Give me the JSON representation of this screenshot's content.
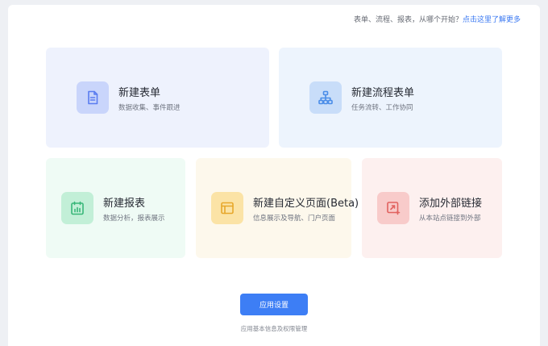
{
  "hint": {
    "text": "表单、流程、报表，从哪个开始？",
    "link": "点击这里了解更多"
  },
  "cards": [
    {
      "title": "新建表单",
      "subtitle": "数据收集、事件跟进",
      "bg": "#eef2fd",
      "icon_bg": "#c9d5fb",
      "icon_color": "#5a7df0",
      "icon": "form-document-icon"
    },
    {
      "title": "新建流程表单",
      "subtitle": "任务流转、工作协同",
      "bg": "#edf4fd",
      "icon_bg": "#c8ddf9",
      "icon_color": "#4a8de8",
      "icon": "workflow-tree-icon"
    },
    {
      "title": "新建报表",
      "subtitle": "数据分析，报表展示",
      "bg": "#effbf5",
      "icon_bg": "#c2efd7",
      "icon_color": "#38b779",
      "icon": "report-chart-icon"
    },
    {
      "title": "新建自定义页面(Beta)",
      "subtitle": "信息展示及导航、门户页面",
      "bg": "#fdf8ec",
      "icon_bg": "#fbe3a6",
      "icon_color": "#e7a72b",
      "icon": "custom-page-icon"
    },
    {
      "title": "添加外部链接",
      "subtitle": "从本站点链接到外部",
      "bg": "#fdf0ef",
      "icon_bg": "#f8cbca",
      "icon_color": "#e1625f",
      "icon": "external-link-icon"
    }
  ],
  "settings": {
    "button": "应用设置",
    "description": "应用基本信息及权限管理"
  }
}
